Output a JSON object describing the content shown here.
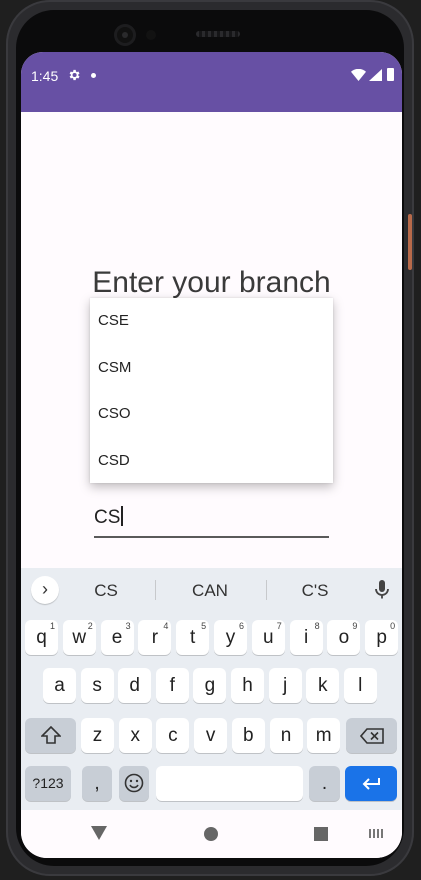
{
  "status_bar": {
    "time": "1:45",
    "icons": [
      "settings-icon",
      "notification-dot",
      "wifi-icon",
      "signal-icon",
      "battery-icon"
    ],
    "color": "#6750a4"
  },
  "main": {
    "title": "Enter your branch"
  },
  "dropdown": {
    "items": [
      "CSE",
      "CSM",
      "CSO",
      "CSD"
    ]
  },
  "input": {
    "value": "CS"
  },
  "keyboard": {
    "suggestions": [
      "CS",
      "CAN",
      "C'S"
    ],
    "row1": [
      {
        "key": "q",
        "hint": "1"
      },
      {
        "key": "w",
        "hint": "2"
      },
      {
        "key": "e",
        "hint": "3"
      },
      {
        "key": "r",
        "hint": "4"
      },
      {
        "key": "t",
        "hint": "5"
      },
      {
        "key": "y",
        "hint": "6"
      },
      {
        "key": "u",
        "hint": "7"
      },
      {
        "key": "i",
        "hint": "8"
      },
      {
        "key": "o",
        "hint": "9"
      },
      {
        "key": "p",
        "hint": "0"
      }
    ],
    "row2": [
      "a",
      "s",
      "d",
      "f",
      "g",
      "h",
      "j",
      "k",
      "l"
    ],
    "row3": [
      "z",
      "x",
      "c",
      "v",
      "b",
      "n",
      "m"
    ],
    "row4": {
      "symbols": "?123",
      "comma": ",",
      "period": "."
    },
    "enter_color": "#1a73e8"
  }
}
